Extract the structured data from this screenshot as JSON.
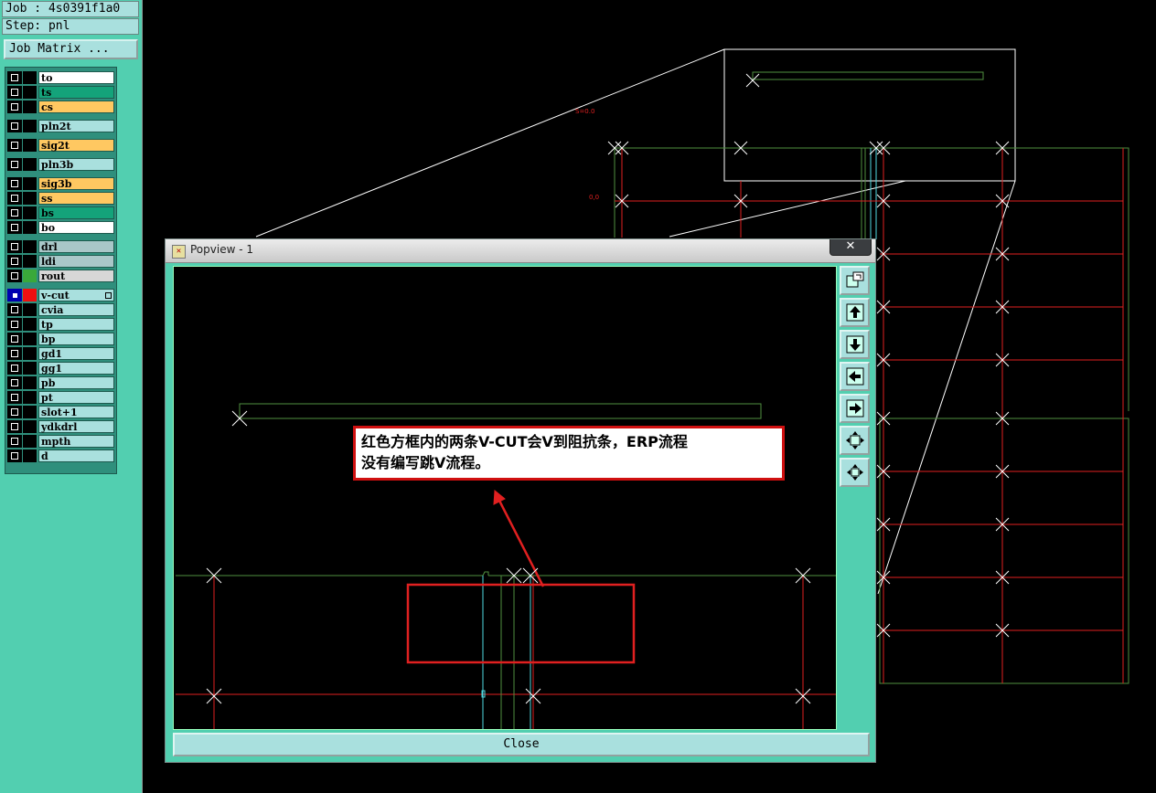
{
  "left_panel": {
    "job": "Job : 4s0391f1a0",
    "step": "Step: pnl",
    "job_matrix_label": "Job Matrix ...",
    "layers": [
      {
        "name": "to",
        "color": "#ffffff",
        "checked": false,
        "flag": false
      },
      {
        "name": "ts",
        "color": "#14a37a",
        "checked": false,
        "flag": false
      },
      {
        "name": "cs",
        "color": "#ffc861",
        "checked": false,
        "flag": false
      },
      {
        "name": "pln2t",
        "color": "#a9e0de",
        "checked": false,
        "flag": false
      },
      {
        "name": "sig2t",
        "color": "#ffc861",
        "checked": false,
        "flag": false
      },
      {
        "name": "pln3b",
        "color": "#a9e0de",
        "checked": false,
        "flag": false
      },
      {
        "name": "sig3b",
        "color": "#ffc861",
        "checked": false,
        "flag": false
      },
      {
        "name": "ss",
        "color": "#ffc861",
        "checked": false,
        "flag": false
      },
      {
        "name": "bs",
        "color": "#14a37a",
        "checked": false,
        "flag": false
      },
      {
        "name": "bo",
        "color": "#ffffff",
        "checked": false,
        "flag": false
      },
      {
        "name": "drl",
        "color": "#a9c7c8",
        "checked": false,
        "flag": false
      },
      {
        "name": "ldi",
        "color": "#a9c7c8",
        "checked": false,
        "flag": false
      },
      {
        "name": "rout",
        "color": "#d7d7d7",
        "checked": false,
        "flag": false,
        "swatch": "#3aa83a"
      },
      {
        "name": "v-cut",
        "color": "#a9e0de",
        "checked": true,
        "flag": true,
        "swatch": "#ee1010"
      },
      {
        "name": "cvia",
        "color": "#a9e0de",
        "checked": false,
        "flag": false
      },
      {
        "name": "tp",
        "color": "#a9e0de",
        "checked": false,
        "flag": false
      },
      {
        "name": "bp",
        "color": "#a9e0de",
        "checked": false,
        "flag": false
      },
      {
        "name": "gd1",
        "color": "#a9e0de",
        "checked": false,
        "flag": false
      },
      {
        "name": "gg1",
        "color": "#a9e0de",
        "checked": false,
        "flag": false
      },
      {
        "name": "pb",
        "color": "#a9e0de",
        "checked": false,
        "flag": false
      },
      {
        "name": "pt",
        "color": "#a9e0de",
        "checked": false,
        "flag": false
      },
      {
        "name": "slot+1",
        "color": "#a9e0de",
        "checked": false,
        "flag": false
      },
      {
        "name": "ydkdrl",
        "color": "#a9e0de",
        "checked": false,
        "flag": false
      },
      {
        "name": "mpth",
        "color": "#a9e0de",
        "checked": false,
        "flag": false
      },
      {
        "name": "d",
        "color": "#a9e0de",
        "checked": false,
        "flag": false
      }
    ]
  },
  "canvas": {
    "label_a": "S=0.0",
    "label_b": "0,0"
  },
  "popview": {
    "title": "Popview - 1",
    "close_x": "✕",
    "close_label": "Close",
    "note_line1": "红色方框内的两条V-CUT会V到阻抗条，ERP流程",
    "note_line2": "没有编写跳V流程。",
    "tools": [
      "zoom-window-icon",
      "pan-up-icon",
      "pan-down-icon",
      "pan-left-icon",
      "pan-right-icon",
      "zoom-out-icon",
      "zoom-fit-icon"
    ]
  },
  "colors": {
    "grid_green": "#4f8f3f",
    "vcut_red": "#e02020",
    "cyan": "#4fd8e0",
    "panel_teal": "#52cfb0"
  }
}
